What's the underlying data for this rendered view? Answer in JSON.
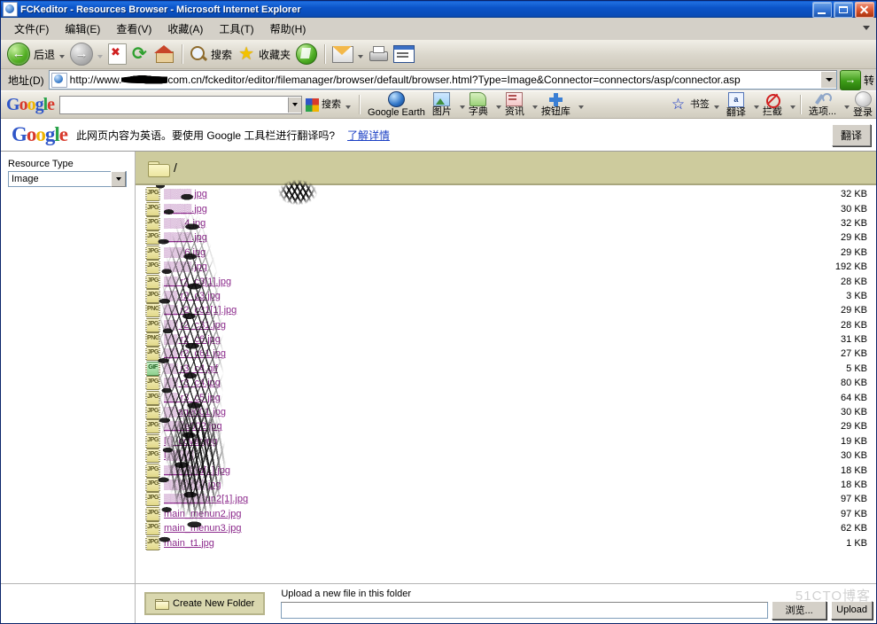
{
  "window": {
    "title": "FCKeditor - Resources Browser - Microsoft Internet Explorer",
    "icon": "ie-document-icon",
    "buttons": {
      "minimize": "_",
      "maximize": "□",
      "close": "✕"
    }
  },
  "menu": {
    "items": [
      {
        "label": "文件(F)"
      },
      {
        "label": "编辑(E)"
      },
      {
        "label": "查看(V)"
      },
      {
        "label": "收藏(A)"
      },
      {
        "label": "工具(T)"
      },
      {
        "label": "帮助(H)"
      }
    ]
  },
  "toolbar": {
    "back_label": "后退",
    "forward_label": "",
    "search_label": "搜索",
    "favorites_label": "收藏夹"
  },
  "address": {
    "label": "地址(D)",
    "url_prefix": "http://www.",
    "url_suffix": "com.cn/fckeditor/editor/filemanager/browser/default/browser.html?Type=Image&Connector=connectors/asp/connector.asp",
    "go_label": "转"
  },
  "google_toolbar": {
    "logo": "Google",
    "search_value": "",
    "search_placeholder": "",
    "items": [
      {
        "label": "搜索",
        "icon": "google-g-icon"
      },
      {
        "label": "Google Earth",
        "icon": "globe-icon"
      },
      {
        "label": "图片",
        "icon": "picture-icon"
      },
      {
        "label": "字典",
        "icon": "dictionary-icon"
      },
      {
        "label": "资讯",
        "icon": "news-icon"
      },
      {
        "label": "按钮库",
        "icon": "plus-icon"
      },
      {
        "label": "书签",
        "icon": "star-icon"
      },
      {
        "label": "翻译",
        "icon": "aa-translate-icon"
      },
      {
        "label": "拦截",
        "icon": "block-icon"
      },
      {
        "label": "选项...",
        "icon": "wrench-icon"
      },
      {
        "label": "登录",
        "icon": "user-icon"
      }
    ]
  },
  "translate_bar": {
    "logo": "Google",
    "message": "此网页内容为英语。要使用 Google 工具栏进行翻译吗?",
    "link": "了解详情",
    "button": "翻译"
  },
  "sidebar": {
    "resource_type_label": "Resource Type",
    "resource_type_value": "Image"
  },
  "folder": {
    "path": "/",
    "icon": "folder-icon"
  },
  "files": {
    "rows": [
      {
        "name": "▒▒▒▒.jpg",
        "size": "32 KB",
        "type": "JPG",
        "obscured": true
      },
      {
        "name": "▒▒▒▒.jpg",
        "size": "30 KB",
        "type": "JPG",
        "obscured": true
      },
      {
        "name": "▒▒▒4.jpg",
        "size": "32 KB",
        "type": "JPG",
        "obscured": true
      },
      {
        "name": "▒▒▒▒.jpg",
        "size": "29 KB",
        "type": "JPG",
        "obscured": true
      },
      {
        "name": "▒▒▒6.jpg",
        "size": "29 KB",
        "type": "JPG",
        "obscured": true
      },
      {
        "name": "▒▒▒▒.jpg",
        "size": "192 KB",
        "type": "JPG",
        "obscured": true
      },
      {
        "name": "▒▒ r2_c3[1].jpg",
        "size": "28 KB",
        "type": "JPG",
        "obscured": true
      },
      {
        "name": "▒▒ r2_c3.jpg",
        "size": "3 KB",
        "type": "JPG",
        "obscured": true
      },
      {
        "name": "▒▒ r2_c31[1].jpg",
        "size": "29 KB",
        "type": "PNG",
        "obscured": true
      },
      {
        "name": "▒▒ r2_c31.jpg",
        "size": "28 KB",
        "type": "JPG",
        "obscured": true
      },
      {
        "name": "▒▒ r2_c6.jpg",
        "size": "31 KB",
        "type": "PNG",
        "obscured": true
      },
      {
        "name": "▒▒ r2_c61.jpg",
        "size": "27 KB",
        "type": "JPG",
        "obscured": true
      },
      {
        "name": "▒▒ r3_c4.gif",
        "size": "5 KB",
        "type": "GIF",
        "obscured": false
      },
      {
        "name": "▒▒ r3_c4.jpg",
        "size": "80 KB",
        "type": "JPG",
        "obscured": true
      },
      {
        "name": "▒▒ r3_c5.jpg",
        "size": "64 KB",
        "type": "JPG",
        "obscured": true
      },
      {
        "name": "▒▒age001.jpg",
        "size": "30 KB",
        "type": "JPG",
        "obscured": true
      },
      {
        "name": "▒▒▒e002.jpg",
        "size": "29 KB",
        "type": "JPG",
        "obscured": true
      },
      {
        "name": "l▒_cover.jpg",
        "size": "19 KB",
        "type": "JPG",
        "obscured": true
      },
      {
        "name": "l▒▒▒▒",
        "size": "30 KB",
        "type": "JPG",
        "obscured": true
      },
      {
        "name": "▒▒▒▒▒d[1].jpg",
        "size": "18 KB",
        "type": "JPG",
        "obscured": true
      },
      {
        "name": "▒▒▒▒▒▒.jpg",
        "size": "18 KB",
        "type": "JPG",
        "obscured": true
      },
      {
        "name": "▒▒▒▒▒▒un2[1].jpg",
        "size": "97 KB",
        "type": "JPG",
        "obscured": true
      },
      {
        "name": "main_menun2.jpg",
        "size": "97 KB",
        "type": "JPG",
        "obscured": false
      },
      {
        "name": "main_menun3.jpg",
        "size": "62 KB",
        "type": "JPG",
        "obscured": false
      },
      {
        "name": "main_t1.jpg",
        "size": "1 KB",
        "type": "JPG",
        "obscured": false
      }
    ]
  },
  "footer": {
    "create_folder_label": "Create New Folder",
    "upload_label": "Upload a new file in this folder",
    "upload_value": "",
    "browse_label": "浏览...",
    "upload_button": "Upload",
    "watermark": "51CTO博客"
  }
}
